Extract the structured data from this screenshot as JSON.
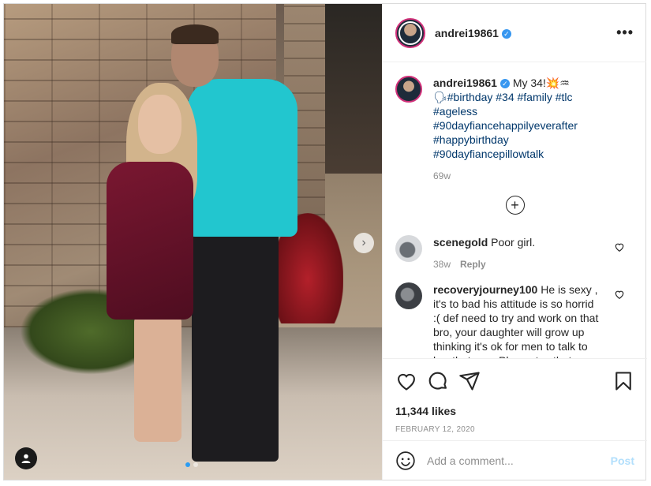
{
  "post": {
    "username": "andrei19861",
    "more_label": "•••",
    "verified_label": "✓",
    "photo_alt": "Couple posing in front of a stone wall at night",
    "carousel_next_label": "›",
    "caption": {
      "username": "andrei19861",
      "text": "My 34!💥♒",
      "hashtags": "🗣#birthday #34 #family #tlc #ageless #90dayfiancehappilyeverafter #happybirthday #90dayfiancepillowtalk",
      "time": "69w"
    },
    "load_more_label": "+",
    "comments": [
      {
        "username": "scenegold",
        "text": "Poor girl.",
        "time": "38w",
        "reply_label": "Reply"
      },
      {
        "username": "recoveryjourney100",
        "text": "He is sexy , it's to bad his attitude is so horrid :( def need to try and work on that bro, your daughter will grow up thinking it's ok for men to talk to her that way. Please try, that"
      }
    ],
    "likes": "11,344 likes",
    "date": "FEBRUARY 12, 2020",
    "add_comment": {
      "placeholder": "Add a comment...",
      "post_label": "Post"
    },
    "icons": {
      "like": "heart-icon",
      "comment": "comment-icon",
      "share": "share-icon",
      "save": "bookmark-icon",
      "emoji": "emoji-icon",
      "tag": "user-tag-icon"
    },
    "colors": {
      "link": "#00376b",
      "verified": "#3897f0",
      "post_button": "#b2dffc",
      "story_ring": "#d1317a",
      "carousel_active_dot": "#2b9cf2"
    }
  }
}
